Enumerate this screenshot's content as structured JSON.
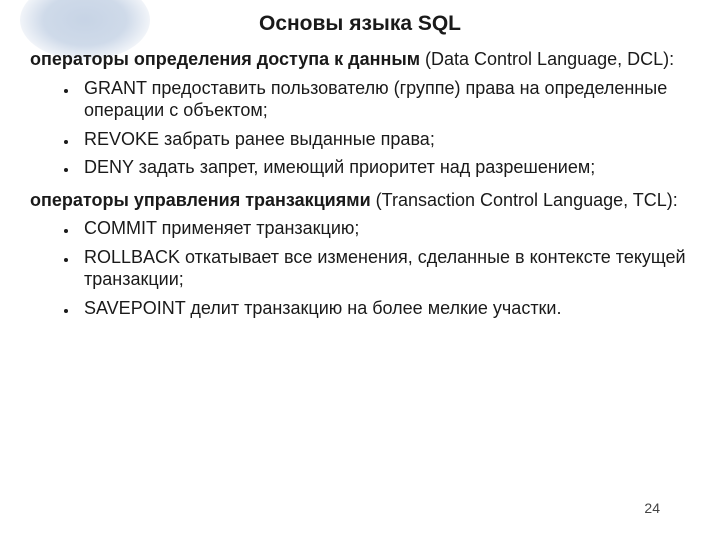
{
  "title": "Основы языка SQL",
  "section1_bold": "операторы определения доступа к данным",
  "section1_rest": " (Data Control Language, DCL):",
  "bullets1": {
    "b0": "GRANT предоставить пользователю (группе) права на определенные операции с объектом;",
    "b1": "REVOKE забрать ранее выданные права;",
    "b2": "DENY задать запрет, имеющий приоритет над разрешением;"
  },
  "section2_bold": "операторы управления транзакциями",
  "section2_rest": " (Transaction Control Language, TCL):",
  "bullets2": {
    "b0": "COMMIT применяет транзакцию;",
    "b1": "ROLLBACK откатывает все изменения, сделанные в контексте текущей транзакции;",
    "b2": "SAVEPOINT делит транзакцию на более мелкие участки."
  },
  "page_number": "24"
}
